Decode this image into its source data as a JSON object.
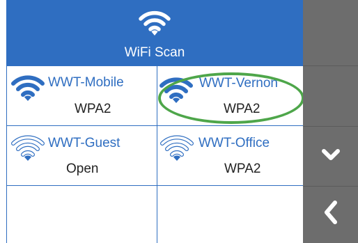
{
  "header": {
    "icon": "wifi-icon",
    "title": "WiFi Scan",
    "background": "#2f6ec1"
  },
  "networks": [
    {
      "ssid": "WWT-Mobile",
      "security": "WPA2",
      "signal": "strong",
      "icon": "wifi-signal-strong-icon"
    },
    {
      "ssid": "WWT-Vernon",
      "security": "WPA2",
      "signal": "strong",
      "icon": "wifi-signal-strong-icon",
      "highlighted": true
    },
    {
      "ssid": "WWT-Guest",
      "security": "Open",
      "signal": "weak",
      "icon": "wifi-signal-weak-icon"
    },
    {
      "ssid": "WWT-Office",
      "security": "WPA2",
      "signal": "weak",
      "icon": "wifi-signal-weak-icon"
    }
  ],
  "sidebar": {
    "buttons": [
      {
        "name": "blank",
        "icon": ""
      },
      {
        "name": "blank",
        "icon": ""
      },
      {
        "name": "scroll-down",
        "icon": "chevron-down-icon"
      },
      {
        "name": "back",
        "icon": "chevron-left-icon"
      }
    ],
    "background": "#6d6d6d"
  },
  "colors": {
    "accent": "#2f6ec1",
    "highlight": "#4ea64a"
  }
}
